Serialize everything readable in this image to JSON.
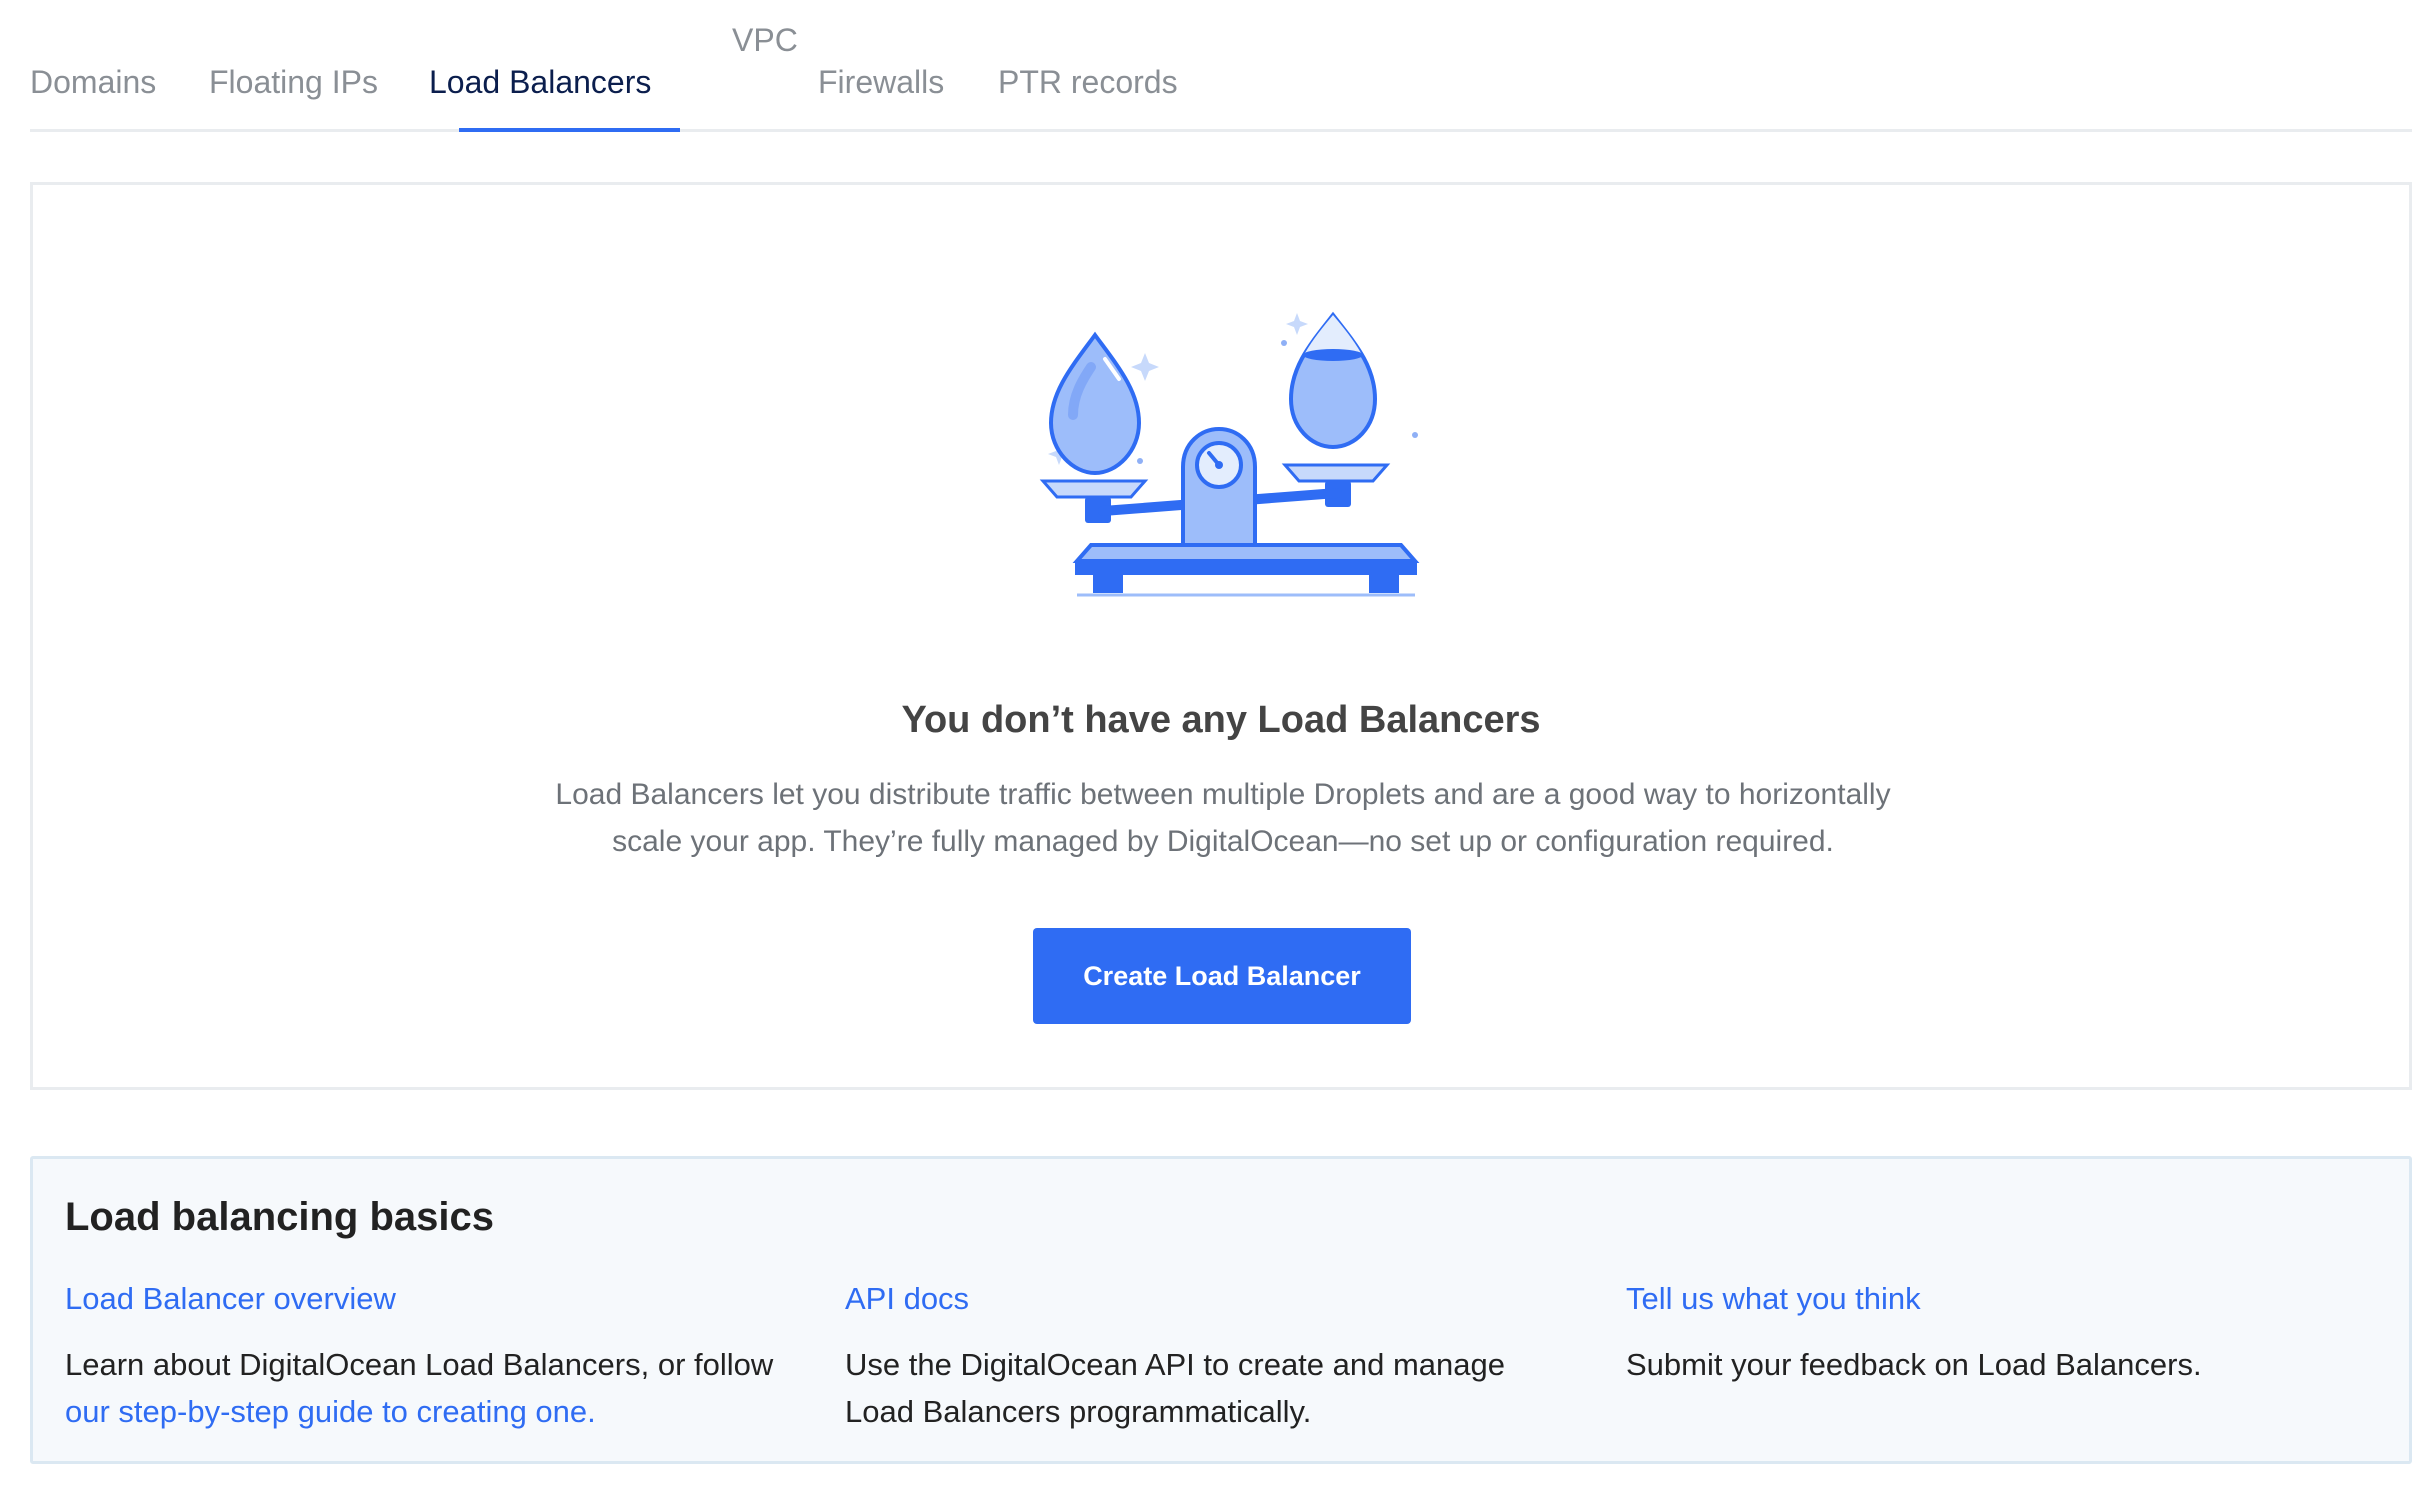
{
  "tabs": {
    "domains": "Domains",
    "floating_ips": "Floating IPs",
    "load_balancers": "Load Balancers",
    "vpc": "VPC",
    "firewalls": "Firewalls",
    "ptr_records": "PTR records",
    "active": "Load Balancers"
  },
  "empty_state": {
    "illustration_icon": "balance-scale-droplets-icon",
    "title": "You don’t have any Load Balancers",
    "description_line1": "Load Balancers let you distribute traffic between multiple Droplets and are a good way to horizontally",
    "description_line2": "scale your app. They’re fully managed by DigitalOcean—no set up or configuration required.",
    "button_label": "Create Load Balancer"
  },
  "basics": {
    "title": "Load balancing basics",
    "columns": [
      {
        "link": "Load Balancer overview",
        "text": "Learn about DigitalOcean Load Balancers, or follow",
        "inline_link": "our step-by-step guide to creating one."
      },
      {
        "link": "API docs",
        "text": "Use the DigitalOcean API to create and manage Load Balancers programmatically."
      },
      {
        "link": "Tell us what you think",
        "text": "Submit your feedback on Load Balancers."
      }
    ]
  },
  "colors": {
    "accent": "#2f6cf3",
    "active_tab": "#0b1e4d",
    "inactive_tab": "#8a8f95",
    "panel_bg": "#f6f9fc"
  }
}
